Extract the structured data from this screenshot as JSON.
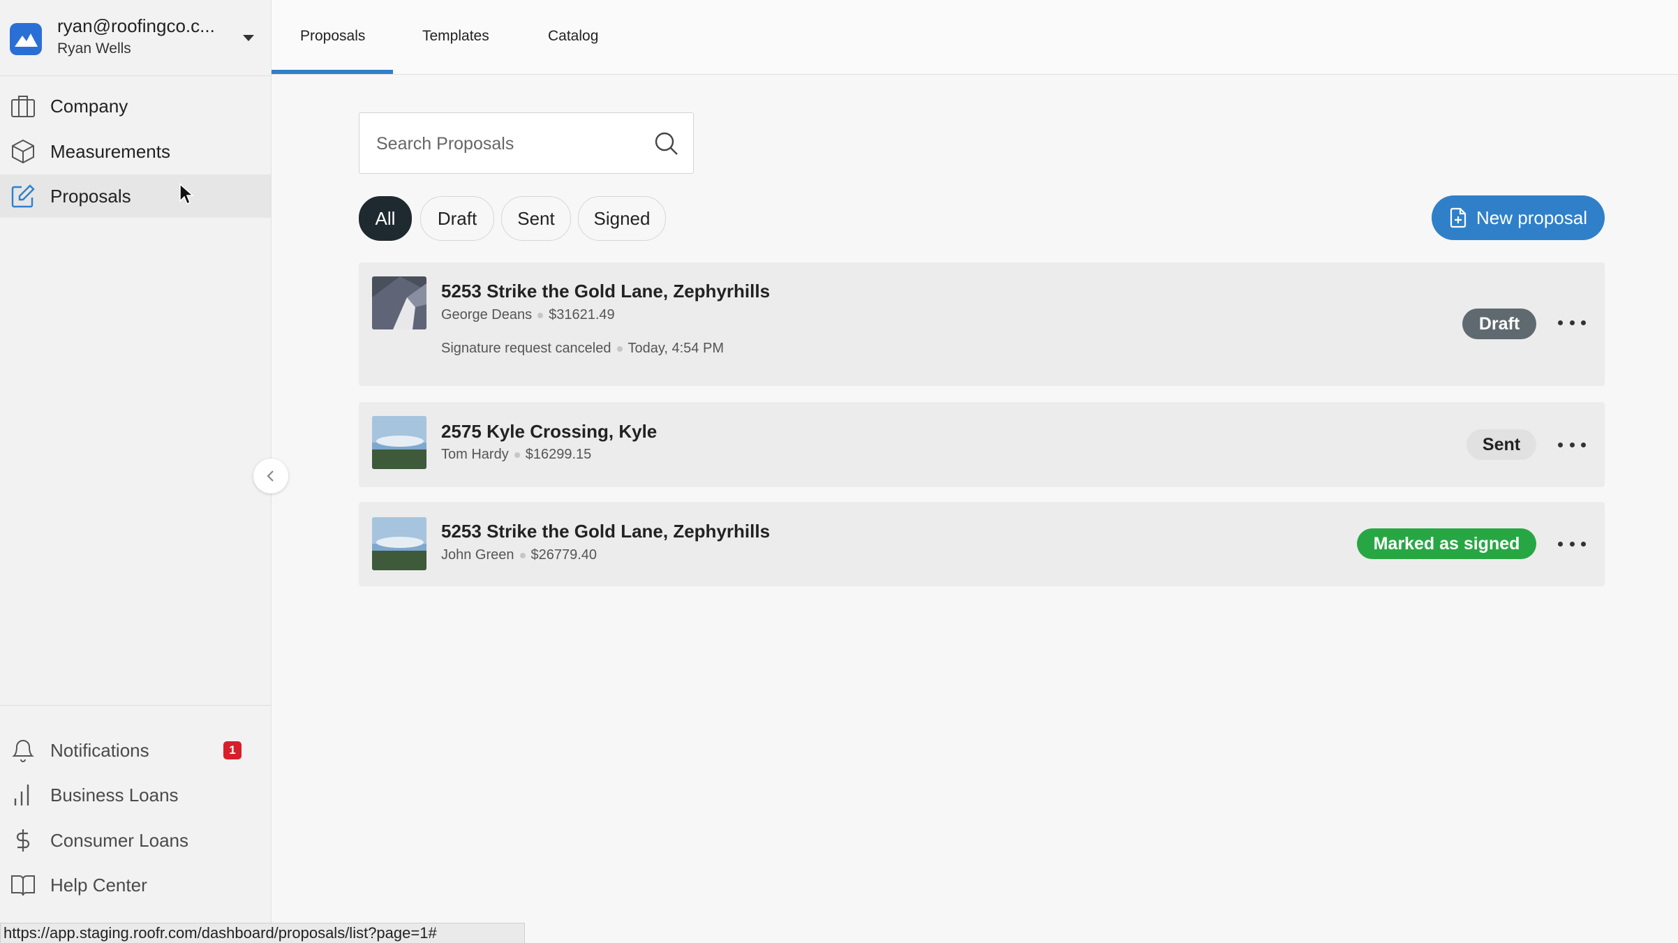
{
  "account": {
    "email": "ryan@roofingco.c...",
    "name": "Ryan Wells",
    "logo_icon": "roofr-logo-icon",
    "dropdown_icon": "caret-down-icon"
  },
  "sidebar": {
    "items": [
      {
        "label": "Company",
        "icon": "building-icon",
        "active": false
      },
      {
        "label": "Measurements",
        "icon": "cube-icon",
        "active": false
      },
      {
        "label": "Proposals",
        "icon": "edit-icon",
        "active": true
      }
    ],
    "bottom_items": [
      {
        "label": "Notifications",
        "icon": "bell-icon",
        "badge": "1"
      },
      {
        "label": "Business Loans",
        "icon": "bar-chart-icon"
      },
      {
        "label": "Consumer Loans",
        "icon": "dollar-icon"
      },
      {
        "label": "Help Center",
        "icon": "book-icon"
      }
    ],
    "collapse_icon": "chevron-left-icon"
  },
  "tabs": [
    {
      "label": "Proposals",
      "active": true
    },
    {
      "label": "Templates",
      "active": false
    },
    {
      "label": "Catalog",
      "active": false
    }
  ],
  "search": {
    "placeholder": "Search Proposals",
    "value": "",
    "icon": "search-icon"
  },
  "filters": [
    {
      "label": "All",
      "active": true
    },
    {
      "label": "Draft",
      "active": false
    },
    {
      "label": "Sent",
      "active": false
    },
    {
      "label": "Signed",
      "active": false
    }
  ],
  "new_proposal": {
    "label": "New proposal",
    "icon": "file-plus-icon"
  },
  "proposals": [
    {
      "address": "5253 Strike the Gold Lane, Zephyrhills",
      "customer": "George Deans",
      "amount": "$31621.49",
      "activity": "Signature request canceled",
      "activity_time": "Today, 4:54 PM",
      "status": "Draft"
    },
    {
      "address": "2575 Kyle Crossing, Kyle",
      "customer": "Tom Hardy",
      "amount": "$16299.15",
      "status": "Sent"
    },
    {
      "address": "5253 Strike the Gold Lane, Zephyrhills",
      "customer": "John Green",
      "amount": "$26779.40",
      "status": "Marked as signed"
    }
  ],
  "colors": {
    "accent": "#2f80c9",
    "draft": "#5f6a70",
    "signed": "#27a744",
    "badge": "#d71f2b"
  },
  "status_url": "https://app.staging.roofr.com/dashboard/proposals/list?page=1#"
}
